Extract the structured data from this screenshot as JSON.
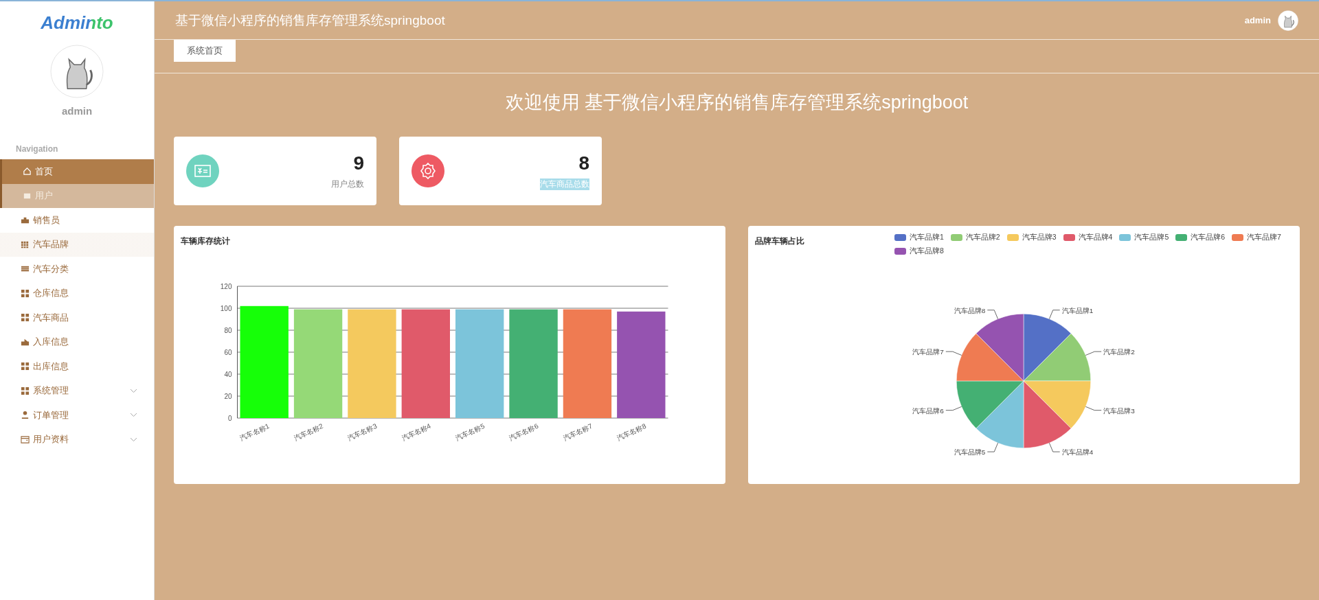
{
  "sidebar": {
    "logo": "Adminto",
    "username": "admin",
    "nav_heading": "Navigation",
    "items": [
      {
        "label": "首页",
        "selected": true,
        "hovered": false,
        "highlighted": false,
        "expandable": false
      },
      {
        "label": "用户",
        "selected": false,
        "hovered": true,
        "highlighted": false,
        "expandable": false
      },
      {
        "label": "销售员",
        "selected": false,
        "hovered": false,
        "highlighted": false,
        "expandable": false
      },
      {
        "label": "汽车品牌",
        "selected": false,
        "hovered": false,
        "highlighted": true,
        "expandable": false
      },
      {
        "label": "汽车分类",
        "selected": false,
        "hovered": false,
        "highlighted": false,
        "expandable": false
      },
      {
        "label": "仓库信息",
        "selected": false,
        "hovered": false,
        "highlighted": false,
        "expandable": false
      },
      {
        "label": "汽车商品",
        "selected": false,
        "hovered": false,
        "highlighted": false,
        "expandable": false
      },
      {
        "label": "入库信息",
        "selected": false,
        "hovered": false,
        "highlighted": false,
        "expandable": false
      },
      {
        "label": "出库信息",
        "selected": false,
        "hovered": false,
        "highlighted": false,
        "expandable": false
      },
      {
        "label": "系统管理",
        "selected": false,
        "hovered": false,
        "highlighted": false,
        "expandable": true
      },
      {
        "label": "订单管理",
        "selected": false,
        "hovered": false,
        "highlighted": false,
        "expandable": true
      },
      {
        "label": "用户资料",
        "selected": false,
        "hovered": false,
        "highlighted": false,
        "expandable": true
      }
    ]
  },
  "header": {
    "title": "基于微信小程序的销售库存管理系统springboot",
    "username": "admin"
  },
  "tabs": [
    {
      "label": "系统首页",
      "selected": true
    }
  ],
  "welcome": "欢迎使用 基于微信小程序的销售库存管理系统springboot",
  "stats": [
    {
      "value": "9",
      "label": "用户总数",
      "color": "#6fd3bf",
      "text_selected": false
    },
    {
      "value": "8",
      "label": "汽车商品总数",
      "color": "#ee5a63",
      "text_selected": true
    }
  ],
  "bar_panel": {
    "title": "车辆库存统计",
    "chart_data": {
      "type": "bar",
      "categories": [
        "汽车名称1",
        "汽车名称2",
        "汽车名称3",
        "汽车名称4",
        "汽车名称5",
        "汽车名称6",
        "汽车名称7",
        "汽车名称8"
      ],
      "series": [
        {
          "colors": [
            "#16ff08",
            "#95d977",
            "#f4c95e",
            "#e05a6a",
            "#7cc4da",
            "#44b073",
            "#ef7b52",
            "#9553b0"
          ],
          "values": [
            102,
            99,
            99,
            99,
            99,
            99,
            99,
            97
          ]
        }
      ],
      "ylim": [
        0,
        120
      ],
      "grid": true,
      "yticks": [
        0,
        20,
        40,
        60,
        80,
        100,
        120
      ]
    }
  },
  "pie_panel": {
    "title": "品牌车辆占比",
    "chart_data": {
      "type": "pie",
      "categories": [
        "汽车品牌1",
        "汽车品牌2",
        "汽车品牌3",
        "汽车品牌4",
        "汽车品牌5",
        "汽车品牌6",
        "汽车品牌7",
        "汽车品牌8"
      ],
      "series": [
        {
          "colors": [
            "#5470c6",
            "#91cc75",
            "#f5c95d",
            "#e05a6a",
            "#7cc4da",
            "#44b073",
            "#ef7b52",
            "#9553b0"
          ],
          "values": [
            1,
            1,
            1,
            1,
            1,
            1,
            1,
            1
          ]
        }
      ]
    }
  }
}
